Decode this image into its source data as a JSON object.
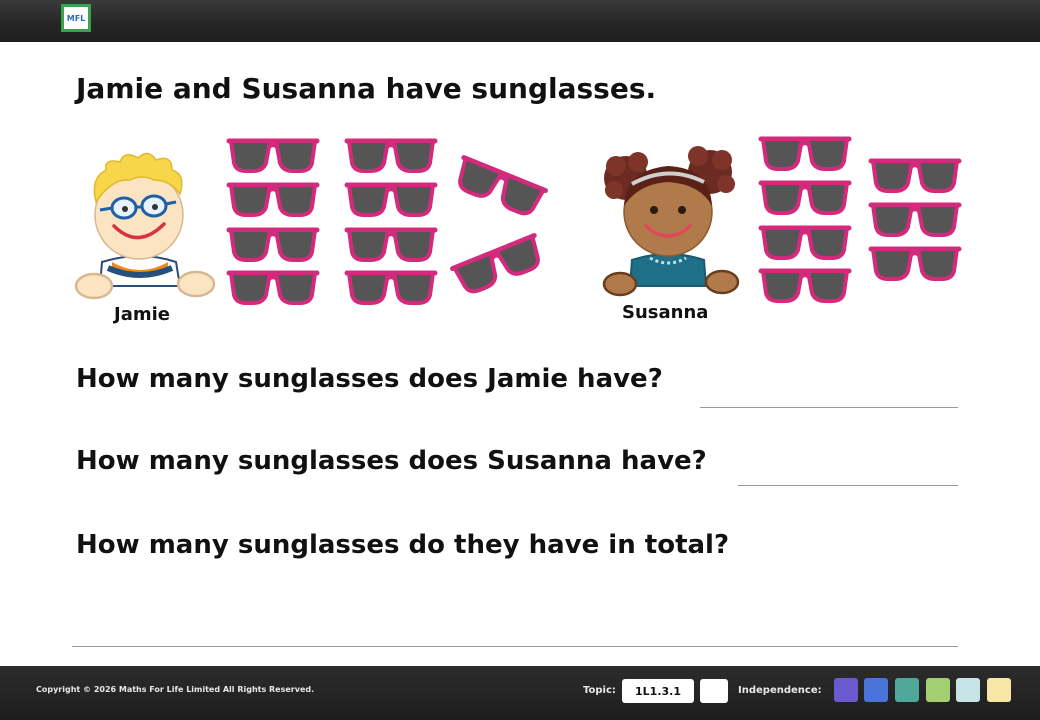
{
  "header": {
    "logo_text": "MFL"
  },
  "heading": "Jamie and Susanna have sunglasses.",
  "children": [
    {
      "name": "Jamie"
    },
    {
      "name": "Susanna"
    }
  ],
  "questions": [
    "How many sunglasses does Jamie have?",
    "How many sunglasses does Susanna have?",
    "How many sunglasses do they have in total?"
  ],
  "footer": {
    "copyright": "Copyright © 2026 Maths For Life Limited All Rights Reserved.",
    "topic_label": "Topic:",
    "topic_code": "1L1.3.1",
    "independence_label": "Independence:",
    "independence_colors": [
      "#6a5acd",
      "#4a74d8",
      "#4fa89a",
      "#a3cf72",
      "#c6e4e8",
      "#f7e7a6"
    ]
  },
  "colors": {
    "frame": "#d42a7d",
    "lens": "#555555"
  }
}
